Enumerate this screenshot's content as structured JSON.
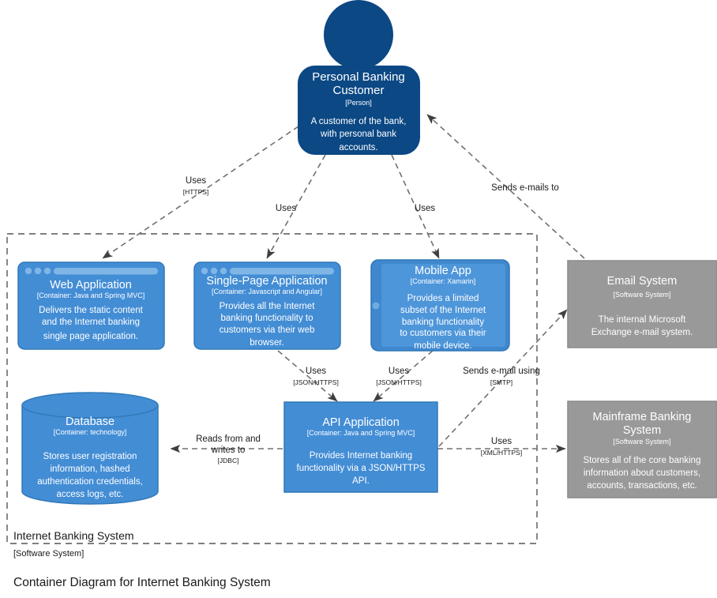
{
  "diagram": {
    "caption": "Container Diagram for Internet Banking System",
    "colors": {
      "person": "#0B4884",
      "container": "#438DD5",
      "container_stroke": "#3179B7",
      "external_system": "#999999",
      "external_stroke": "#8A8A8A",
      "line": "#707070",
      "boundary": "#555555",
      "text_light": "#FFFFFF",
      "text_dark": "#1A1A1A",
      "background": "#FFFFFF"
    }
  },
  "boundary": {
    "title": "Internet Banking System",
    "tech": "[Software System]"
  },
  "nodes": {
    "person": {
      "name": "Personal Banking Customer",
      "name_line1": "Personal Banking",
      "name_line2": "Customer",
      "tech": "[Person]",
      "desc_lines": [
        "A customer of the bank,",
        "with personal bank",
        "accounts."
      ],
      "shape": "person"
    },
    "web_application": {
      "name": "Web Application",
      "tech": "[Container: Java and Spring MVC]",
      "desc_lines": [
        "Delivers the static content",
        "and the Internet banking",
        "single page application."
      ],
      "shape": "browser-window"
    },
    "single_page_application": {
      "name": "Single-Page Application",
      "tech": "[Container: Javascript and Angular]",
      "desc_lines": [
        "Provides all the Internet",
        "banking functionality to",
        "customers via their web",
        "browser."
      ],
      "shape": "browser-window"
    },
    "mobile_app": {
      "name": "Mobile App",
      "tech": "[Container: Xamarin]",
      "desc_lines": [
        "Provides a limited",
        "subset of the Internet",
        "banking functionality",
        "to customers via their",
        "mobile device."
      ],
      "shape": "mobile-device"
    },
    "email_system": {
      "name": "Email System",
      "tech": "[Software System]",
      "desc_lines": [
        "The internal Microsoft",
        "Exchange e-mail system."
      ],
      "shape": "rectangle"
    },
    "database": {
      "name": "Database",
      "tech": "[Container: technology]",
      "desc_lines": [
        "Stores user registration",
        "information, hashed",
        "authentication credentials,",
        "access logs, etc."
      ],
      "shape": "cylinder"
    },
    "api_application": {
      "name": "API Application",
      "tech": "[Container: Java and Spring MVC]",
      "desc_lines": [
        "Provides Internet banking",
        "functionality via a JSON/HTTPS",
        "API."
      ],
      "shape": "rectangle"
    },
    "mainframe_banking_system": {
      "name": "Mainframe Banking System",
      "name_line1": "Mainframe Banking",
      "name_line2": "System",
      "tech": "[Software System]",
      "desc_lines": [
        "Stores all of the core banking",
        "information about customers,",
        "accounts, transactions, etc."
      ],
      "shape": "rectangle"
    }
  },
  "relationships": [
    {
      "id": "person-to-web",
      "label": "Uses",
      "tech": "[HTTPS]",
      "from": "person",
      "to": "web_application"
    },
    {
      "id": "person-to-spa",
      "label": "Uses",
      "tech": "",
      "from": "person",
      "to": "single_page_application"
    },
    {
      "id": "person-to-mobile",
      "label": "Uses",
      "tech": "",
      "from": "person",
      "to": "mobile_app"
    },
    {
      "id": "email-to-person",
      "label": "Sends e-mails to",
      "tech": "",
      "from": "email_system",
      "to": "person"
    },
    {
      "id": "spa-to-api",
      "label": "Uses",
      "tech": "[JSON/HTTPS]",
      "from": "single_page_application",
      "to": "api_application"
    },
    {
      "id": "mobile-to-api",
      "label": "Uses",
      "tech": "[JSON/HTTPS]",
      "from": "mobile_app",
      "to": "api_application"
    },
    {
      "id": "api-to-email",
      "label": "Sends e-mail using",
      "tech": "[SMTP]",
      "from": "api_application",
      "to": "email_system"
    },
    {
      "id": "api-to-database",
      "label_line1": "Reads from and",
      "label_line2": "writes to",
      "label": "Reads from and writes to",
      "tech": "[JDBC]",
      "from": "api_application",
      "to": "database"
    },
    {
      "id": "api-to-mainframe",
      "label": "Uses",
      "tech": "[XML/HTTPS]",
      "from": "api_application",
      "to": "mainframe_banking_system"
    }
  ]
}
